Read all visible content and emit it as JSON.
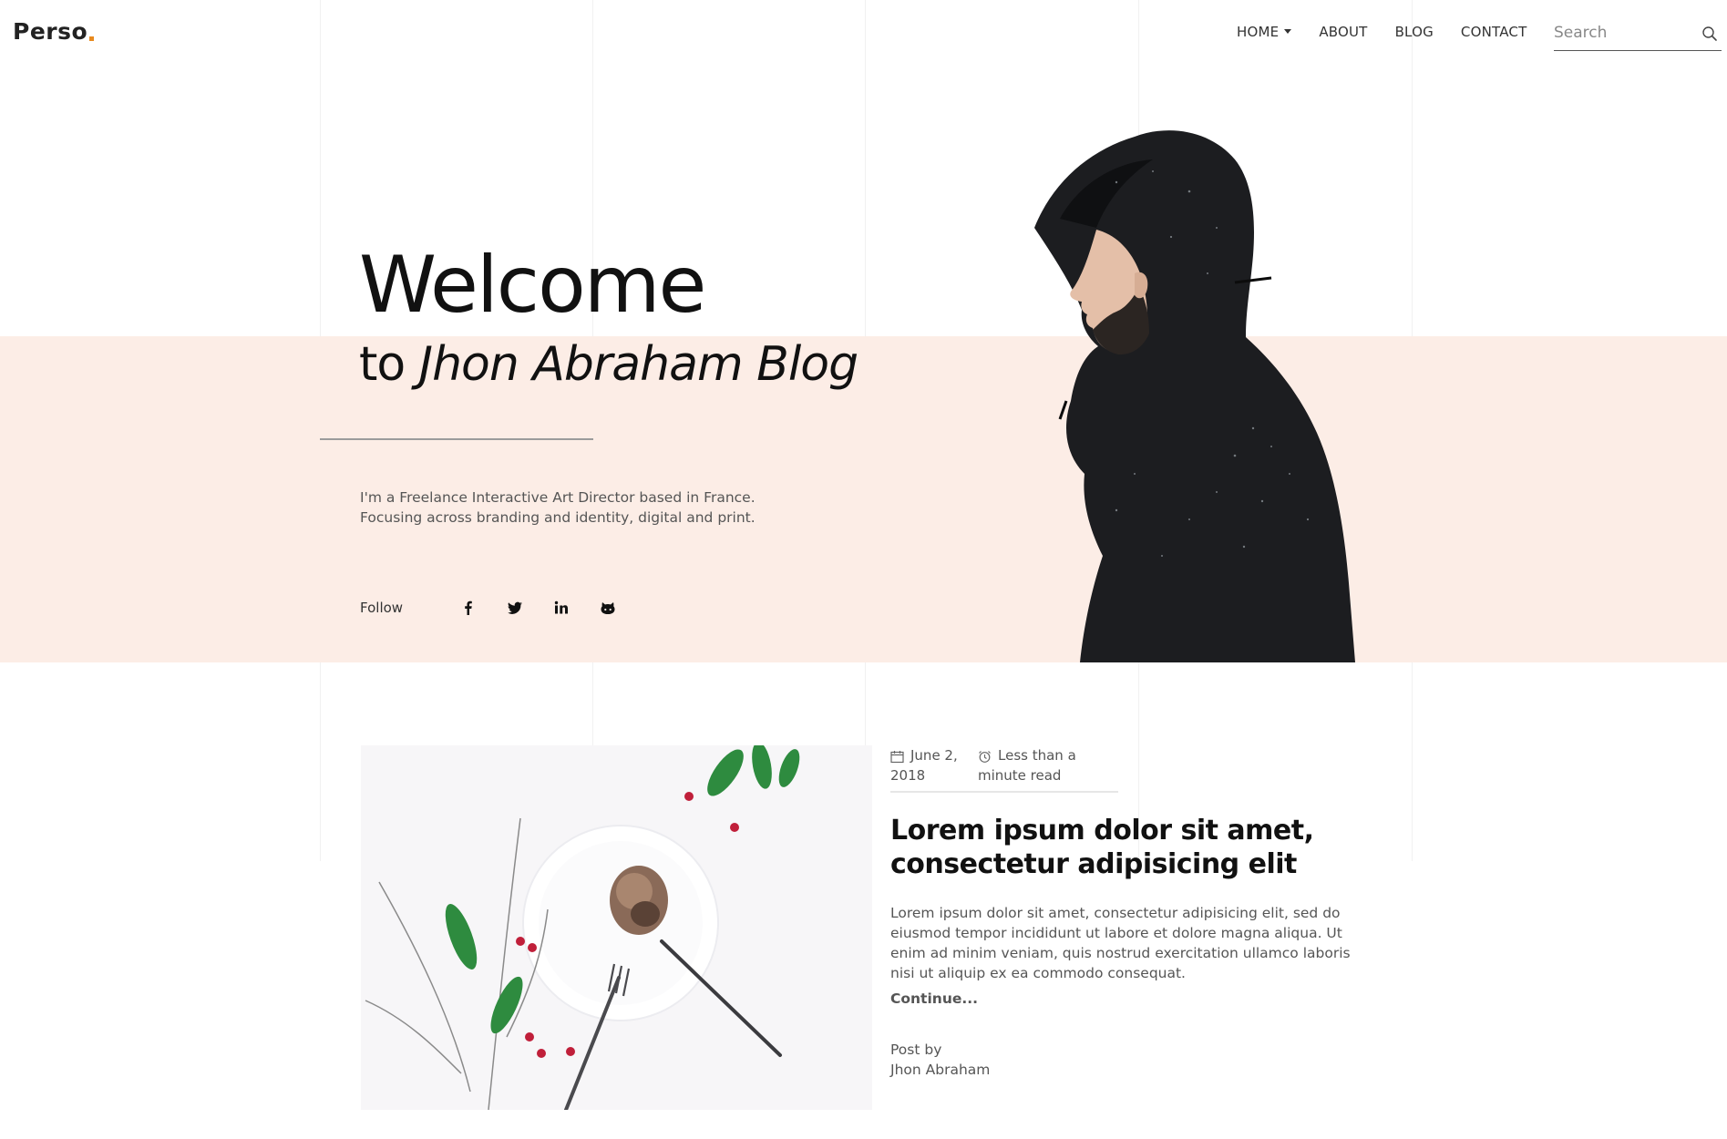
{
  "site": {
    "logo": "Perso",
    "accent_color": "#e88a1f",
    "hero_bg_color": "#fcede6"
  },
  "nav": {
    "items": [
      {
        "label": "HOME",
        "has_dropdown": true
      },
      {
        "label": "ABOUT",
        "has_dropdown": false
      },
      {
        "label": "BLOG",
        "has_dropdown": false
      },
      {
        "label": "CONTACT",
        "has_dropdown": false
      }
    ],
    "search_placeholder": "Search",
    "search_icon": "search-icon"
  },
  "hero": {
    "title": "Welcome",
    "subtitle_prefix": "to",
    "subtitle_name": "Jhon Abraham Blog",
    "description": "I'm a Freelance Interactive Art Director based in France. Focusing across branding and identity, digital and print.",
    "follow_label": "Follow",
    "social_icons": [
      "facebook-icon",
      "twitter-icon",
      "linkedin-icon",
      "github-icon"
    ]
  },
  "post": {
    "date_line1": "June 2,",
    "date_line2": "2018",
    "read_line1": "Less than a",
    "read_line2": "minute read",
    "title": "Lorem ipsum dolor sit amet, consectetur adipisicing elit",
    "excerpt": "Lorem ipsum dolor sit amet, consectetur adipisicing elit, sed do eiusmod tempor incididunt ut labore et dolore magna aliqua. Ut enim ad minim veniam, quis nostrud exercitation ullamco laboris nisi ut aliquip ex ea commodo consequat.",
    "continue_label": "Continue...",
    "posted_by_label": "Post by",
    "author": "Jhon Abraham"
  }
}
